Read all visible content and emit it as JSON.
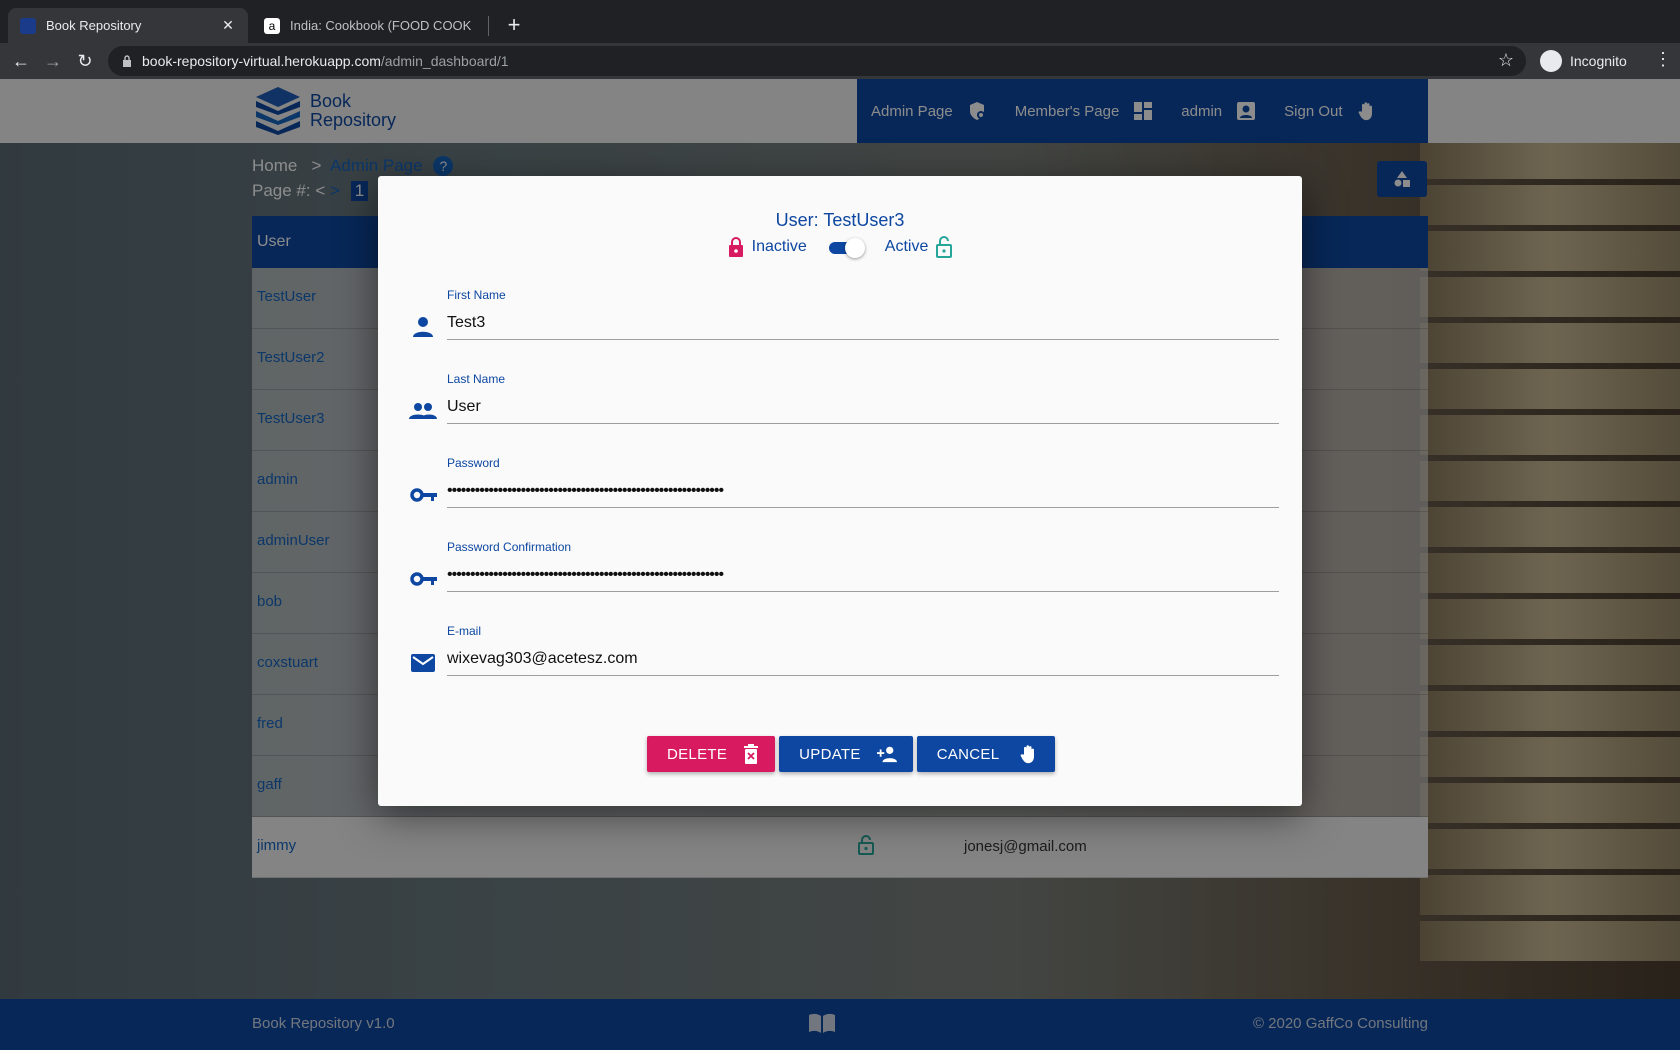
{
  "browser": {
    "tabs": [
      {
        "title": "Book Repository",
        "active": true
      },
      {
        "title": "India: Cookbook (FOOD COOK",
        "active": false
      }
    ],
    "url_host": "book-repository-virtual.herokuapp.com",
    "url_path": "/admin_dashboard/1",
    "profile": "Incognito"
  },
  "app": {
    "logo_line1": "Book",
    "logo_line2": "Repository",
    "nav": [
      {
        "label": "Admin Page",
        "icon": "admin-shield-icon"
      },
      {
        "label": "Member's Page",
        "icon": "dashboard-icon"
      },
      {
        "label": "admin",
        "icon": "account-box-icon"
      },
      {
        "label": "Sign Out",
        "icon": "hand-wave-icon"
      }
    ],
    "breadcrumb_home": "Home",
    "breadcrumb_sep": ">",
    "breadcrumb_current": "Admin Page",
    "help": "?",
    "page_label": "Page #:",
    "page_prev": "<",
    "page_next": ">",
    "page_current": "1",
    "table_header": "User",
    "users": [
      "TestUser",
      "TestUser2",
      "TestUser3",
      "admin",
      "adminUser",
      "bob",
      "coxstuart",
      "fred",
      "gaff",
      "jimmy"
    ],
    "last_row_email": "jonesj@gmail.com",
    "footer_left": "Book Repository v1.0",
    "footer_right": "© 2020 GaffCo Consulting"
  },
  "modal": {
    "title": "User: TestUser3",
    "inactive_label": "Inactive",
    "active_label": "Active",
    "active": true,
    "fields": {
      "first_name_label": "First Name",
      "first_name": "Test3",
      "last_name_label": "Last Name",
      "last_name": "User",
      "password_label": "Password",
      "password": "••••••••••••••••••••••••••••••••••••••••••••••••••••••••••••",
      "password_confirm_label": "Password Confirmation",
      "password_confirm": "••••••••••••••••••••••••••••••••••••••••••••••••••••••••••••",
      "email_label": "E-mail",
      "email": "wixevag303@acetesz.com"
    },
    "buttons": {
      "delete": "DELETE",
      "update": "UPDATE",
      "cancel": "CANCEL"
    }
  },
  "colors": {
    "primary": "#0d47a1",
    "danger": "#d81b60",
    "success": "#26a69a"
  }
}
